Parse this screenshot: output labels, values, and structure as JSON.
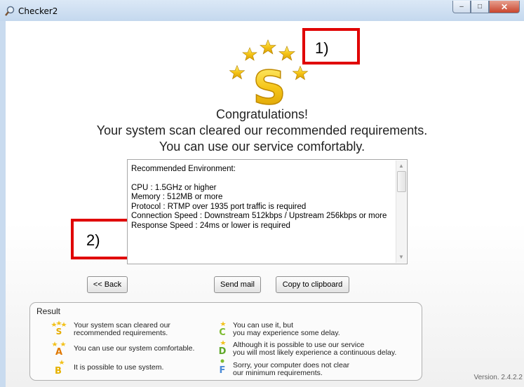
{
  "window": {
    "title": "Checker2",
    "close_glyph": "✕",
    "maximize_glyph": "□",
    "minimize_glyph": "–"
  },
  "annotations": {
    "label1": "1)",
    "label2": "2)"
  },
  "message": {
    "line1": "Congratulations!",
    "line2": "Your system scan cleared our recommended requirements.",
    "line3": "You can use our service comfortably."
  },
  "environment": {
    "heading": "Recommended Environment:",
    "lines": [
      "CPU : 1.5GHz or higher",
      "Memory : 512MB or more",
      "Protocol : RTMP over 1935 port traffic is required",
      "Connection Speed : Downstream 512kbps / Upstream 256kbps or more",
      "Response Speed : 24ms or lower is required"
    ]
  },
  "buttons": {
    "back": "<< Back",
    "send_mail": "Send mail",
    "copy": "Copy to clipboard"
  },
  "result": {
    "title": "Result",
    "items": [
      {
        "grade": "S",
        "icon": "grade-s-stars-icon",
        "line1": "Your system scan cleared our",
        "line2": "recommended requirements."
      },
      {
        "grade": "A",
        "icon": "grade-a-stars-icon",
        "line1": "You can use our system comfortable.",
        "line2": ""
      },
      {
        "grade": "B",
        "icon": "grade-b-star-icon",
        "line1": "It is possible to use system.",
        "line2": ""
      },
      {
        "grade": "C",
        "icon": "grade-c-star-icon",
        "line1": "You can use it, but",
        "line2": "you may experience some delay."
      },
      {
        "grade": "D",
        "icon": "grade-d-star-icon",
        "line1": "Although it is possible to use our service",
        "line2": "you will most likely experience a continuous delay."
      },
      {
        "grade": "F",
        "icon": "grade-f-icon",
        "line1": "Sorry, your computer does not clear",
        "line2": "our minimum requirements."
      }
    ]
  },
  "version": "Version. 2.4.2.2",
  "colors": {
    "gold": "#f2c11a",
    "gold_dark": "#c99a00",
    "annotation_red": "#e00000",
    "grade_c_green": "#7dbb2f",
    "grade_d_green": "#5fa82a",
    "grade_f_blue": "#4a8ad6"
  }
}
